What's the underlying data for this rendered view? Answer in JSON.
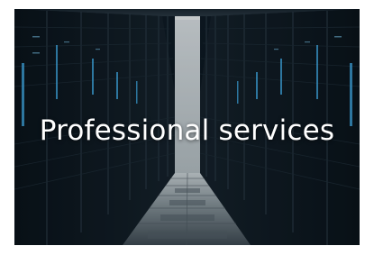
{
  "tile": {
    "caption": "Professional services",
    "image_icon": "server-room-image"
  },
  "colors": {
    "caption": "#ffffff",
    "background": "#ffffff",
    "scene_dark": "#0b1620",
    "led_blue": "#3fa7e0",
    "corridor_light": "#c9d3d8"
  }
}
